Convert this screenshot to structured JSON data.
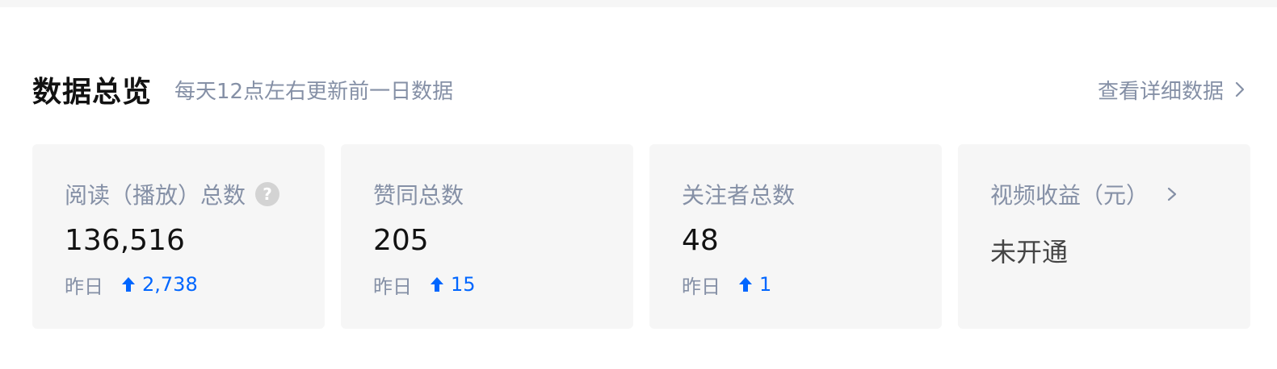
{
  "header": {
    "title": "数据总览",
    "subtitle": "每天12点左右更新前一日数据",
    "detail_link": "查看详细数据"
  },
  "colors": {
    "accent": "#0066ff",
    "muted_text": "#8590a6",
    "card_bg": "#f6f6f6"
  },
  "cards": [
    {
      "label": "阅读（播放）总数",
      "value": "136,516",
      "delta_label": "昨日",
      "delta_value": "2,738",
      "icon": "question-circle-icon"
    },
    {
      "label": "赞同总数",
      "value": "205",
      "delta_label": "昨日",
      "delta_value": "15"
    },
    {
      "label": "关注者总数",
      "value": "48",
      "delta_label": "昨日",
      "delta_value": "1"
    },
    {
      "label": "视频收益（元）",
      "status": "未开通",
      "icon": "chevron-right-icon"
    }
  ]
}
